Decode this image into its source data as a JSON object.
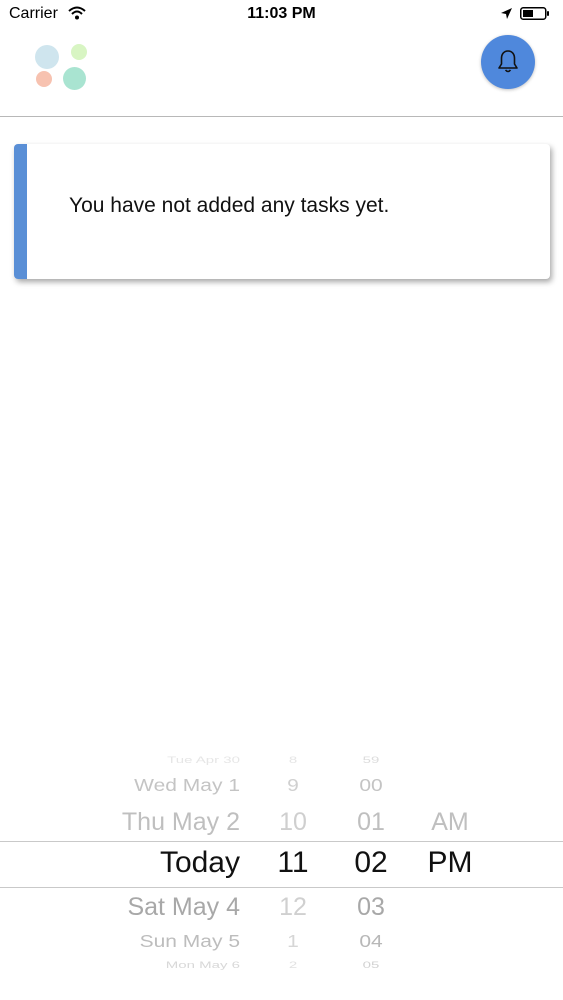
{
  "status_bar": {
    "carrier": "Carrier",
    "time": "11:03 PM"
  },
  "header": {
    "logo_colors": [
      "#cfe5ee",
      "#d8f5c3",
      "#f7c2b0",
      "#a9e4d1"
    ],
    "bell_icon": "bell-icon",
    "accent_color": "#4f88dc"
  },
  "empty_state": {
    "message": "You have not added any tasks yet."
  },
  "picker": {
    "days": [
      "Tue Apr 30",
      "Wed May 1",
      "Thu May 2",
      "Today",
      "Sat May 4",
      "Sun May 5",
      "Mon May 6"
    ],
    "hours": [
      "8",
      "9",
      "10",
      "11",
      "12",
      "1",
      "2"
    ],
    "minutes": [
      "59",
      "00",
      "01",
      "02",
      "03",
      "04",
      "05"
    ],
    "ampm": [
      "AM",
      "PM"
    ],
    "selected": {
      "day": "Today",
      "hour": "11",
      "minute": "02",
      "ampm": "PM"
    }
  }
}
